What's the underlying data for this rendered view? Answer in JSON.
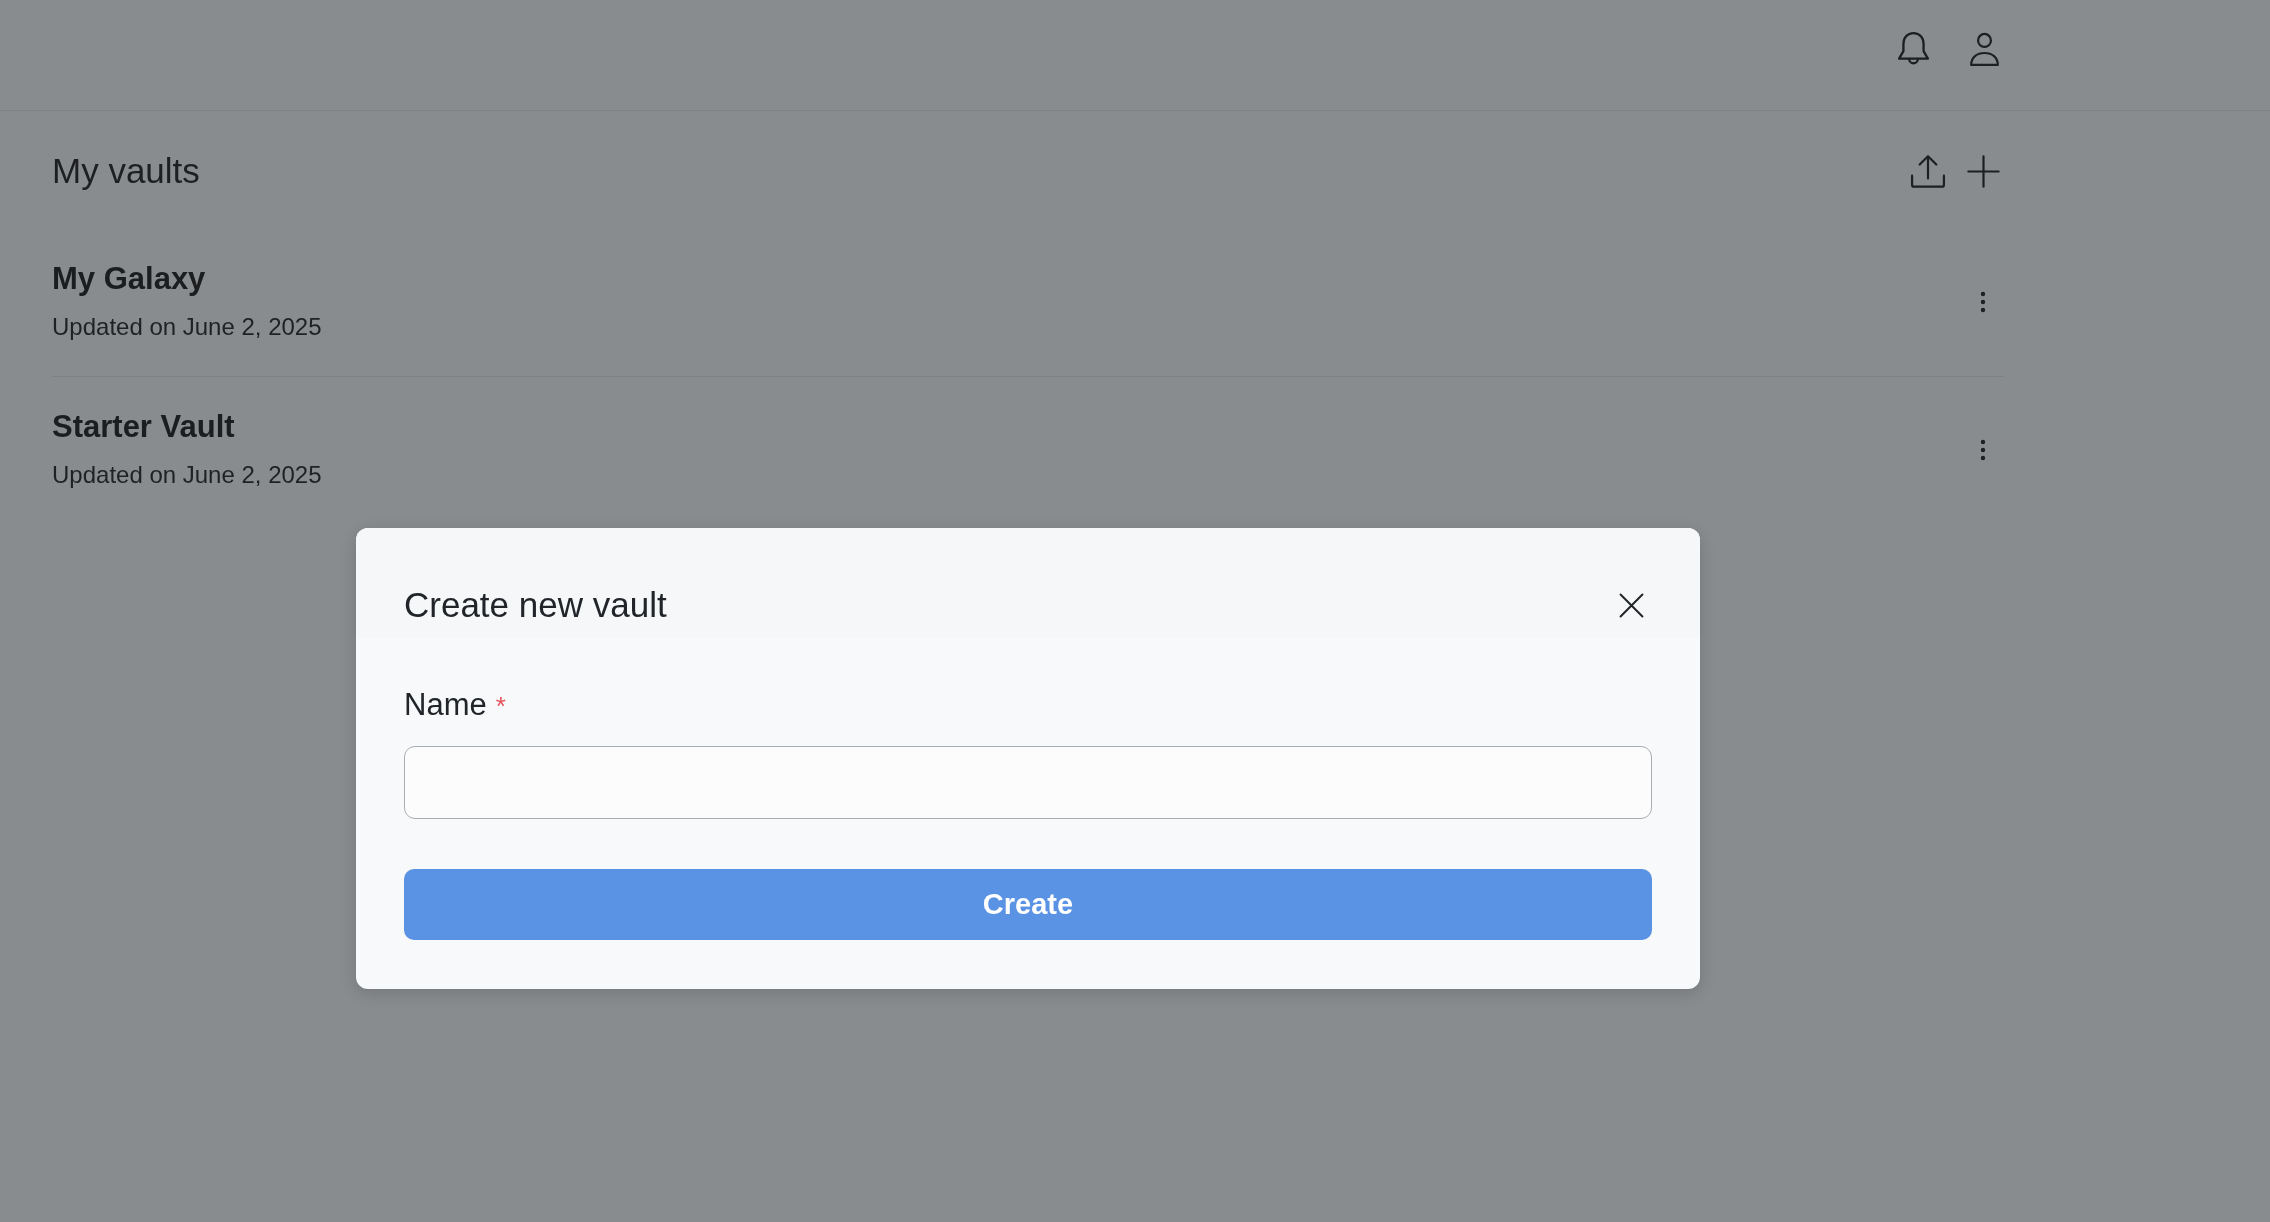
{
  "page_title": "My vaults",
  "vaults": [
    {
      "name": "My Galaxy",
      "updated": "Updated on June 2, 2025"
    },
    {
      "name": "Starter Vault",
      "updated": "Updated on June 2, 2025"
    }
  ],
  "dialog": {
    "title": "Create new vault",
    "field": {
      "label": "Name",
      "required_mark": "*"
    },
    "submit_button": "Create"
  }
}
